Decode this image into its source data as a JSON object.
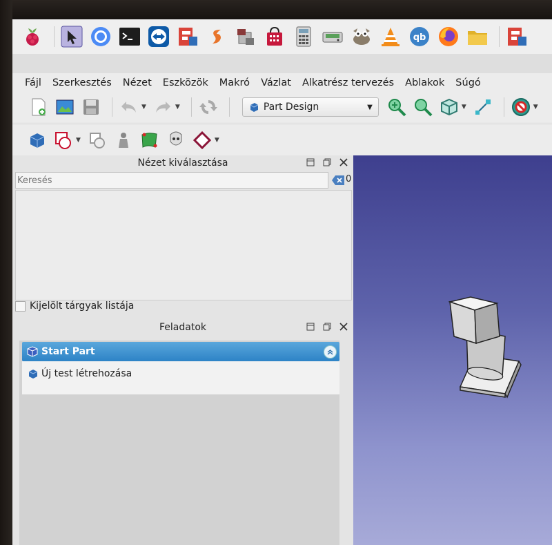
{
  "taskbar": {
    "icons": [
      "raspberry-menu-icon",
      "cursor-icon",
      "chromium-icon",
      "terminal-icon",
      "teamviewer-icon",
      "freecad-icon",
      "gimp-like-icon",
      "package-icon",
      "shopping-bag-icon",
      "calculator-icon",
      "disk-icon",
      "gimp-icon",
      "vlc-icon",
      "qbittorrent-icon",
      "firefox-icon",
      "folder-icon",
      "freecad-icon-2"
    ]
  },
  "menu": {
    "items": [
      "Fájl",
      "Szerkesztés",
      "Nézet",
      "Eszközök",
      "Makró",
      "Vázlat",
      "Alkatrész tervezés",
      "Ablakok",
      "Súgó"
    ]
  },
  "toolbar": {
    "workbench": "Part Design"
  },
  "selection_panel": {
    "title": "Nézet kiválasztása",
    "search_placeholder": "Keresés",
    "count": "0",
    "checkbox_label": "Kijelölt tárgyak listája"
  },
  "tasks_panel": {
    "title": "Feladatok",
    "section_title": "Start Part",
    "action_label": "Új test létrehozása"
  },
  "colors": {
    "header_blue": "#2d83c6",
    "view_bg_top": "#3e3f8e",
    "view_bg_bottom": "#a7aad8"
  }
}
